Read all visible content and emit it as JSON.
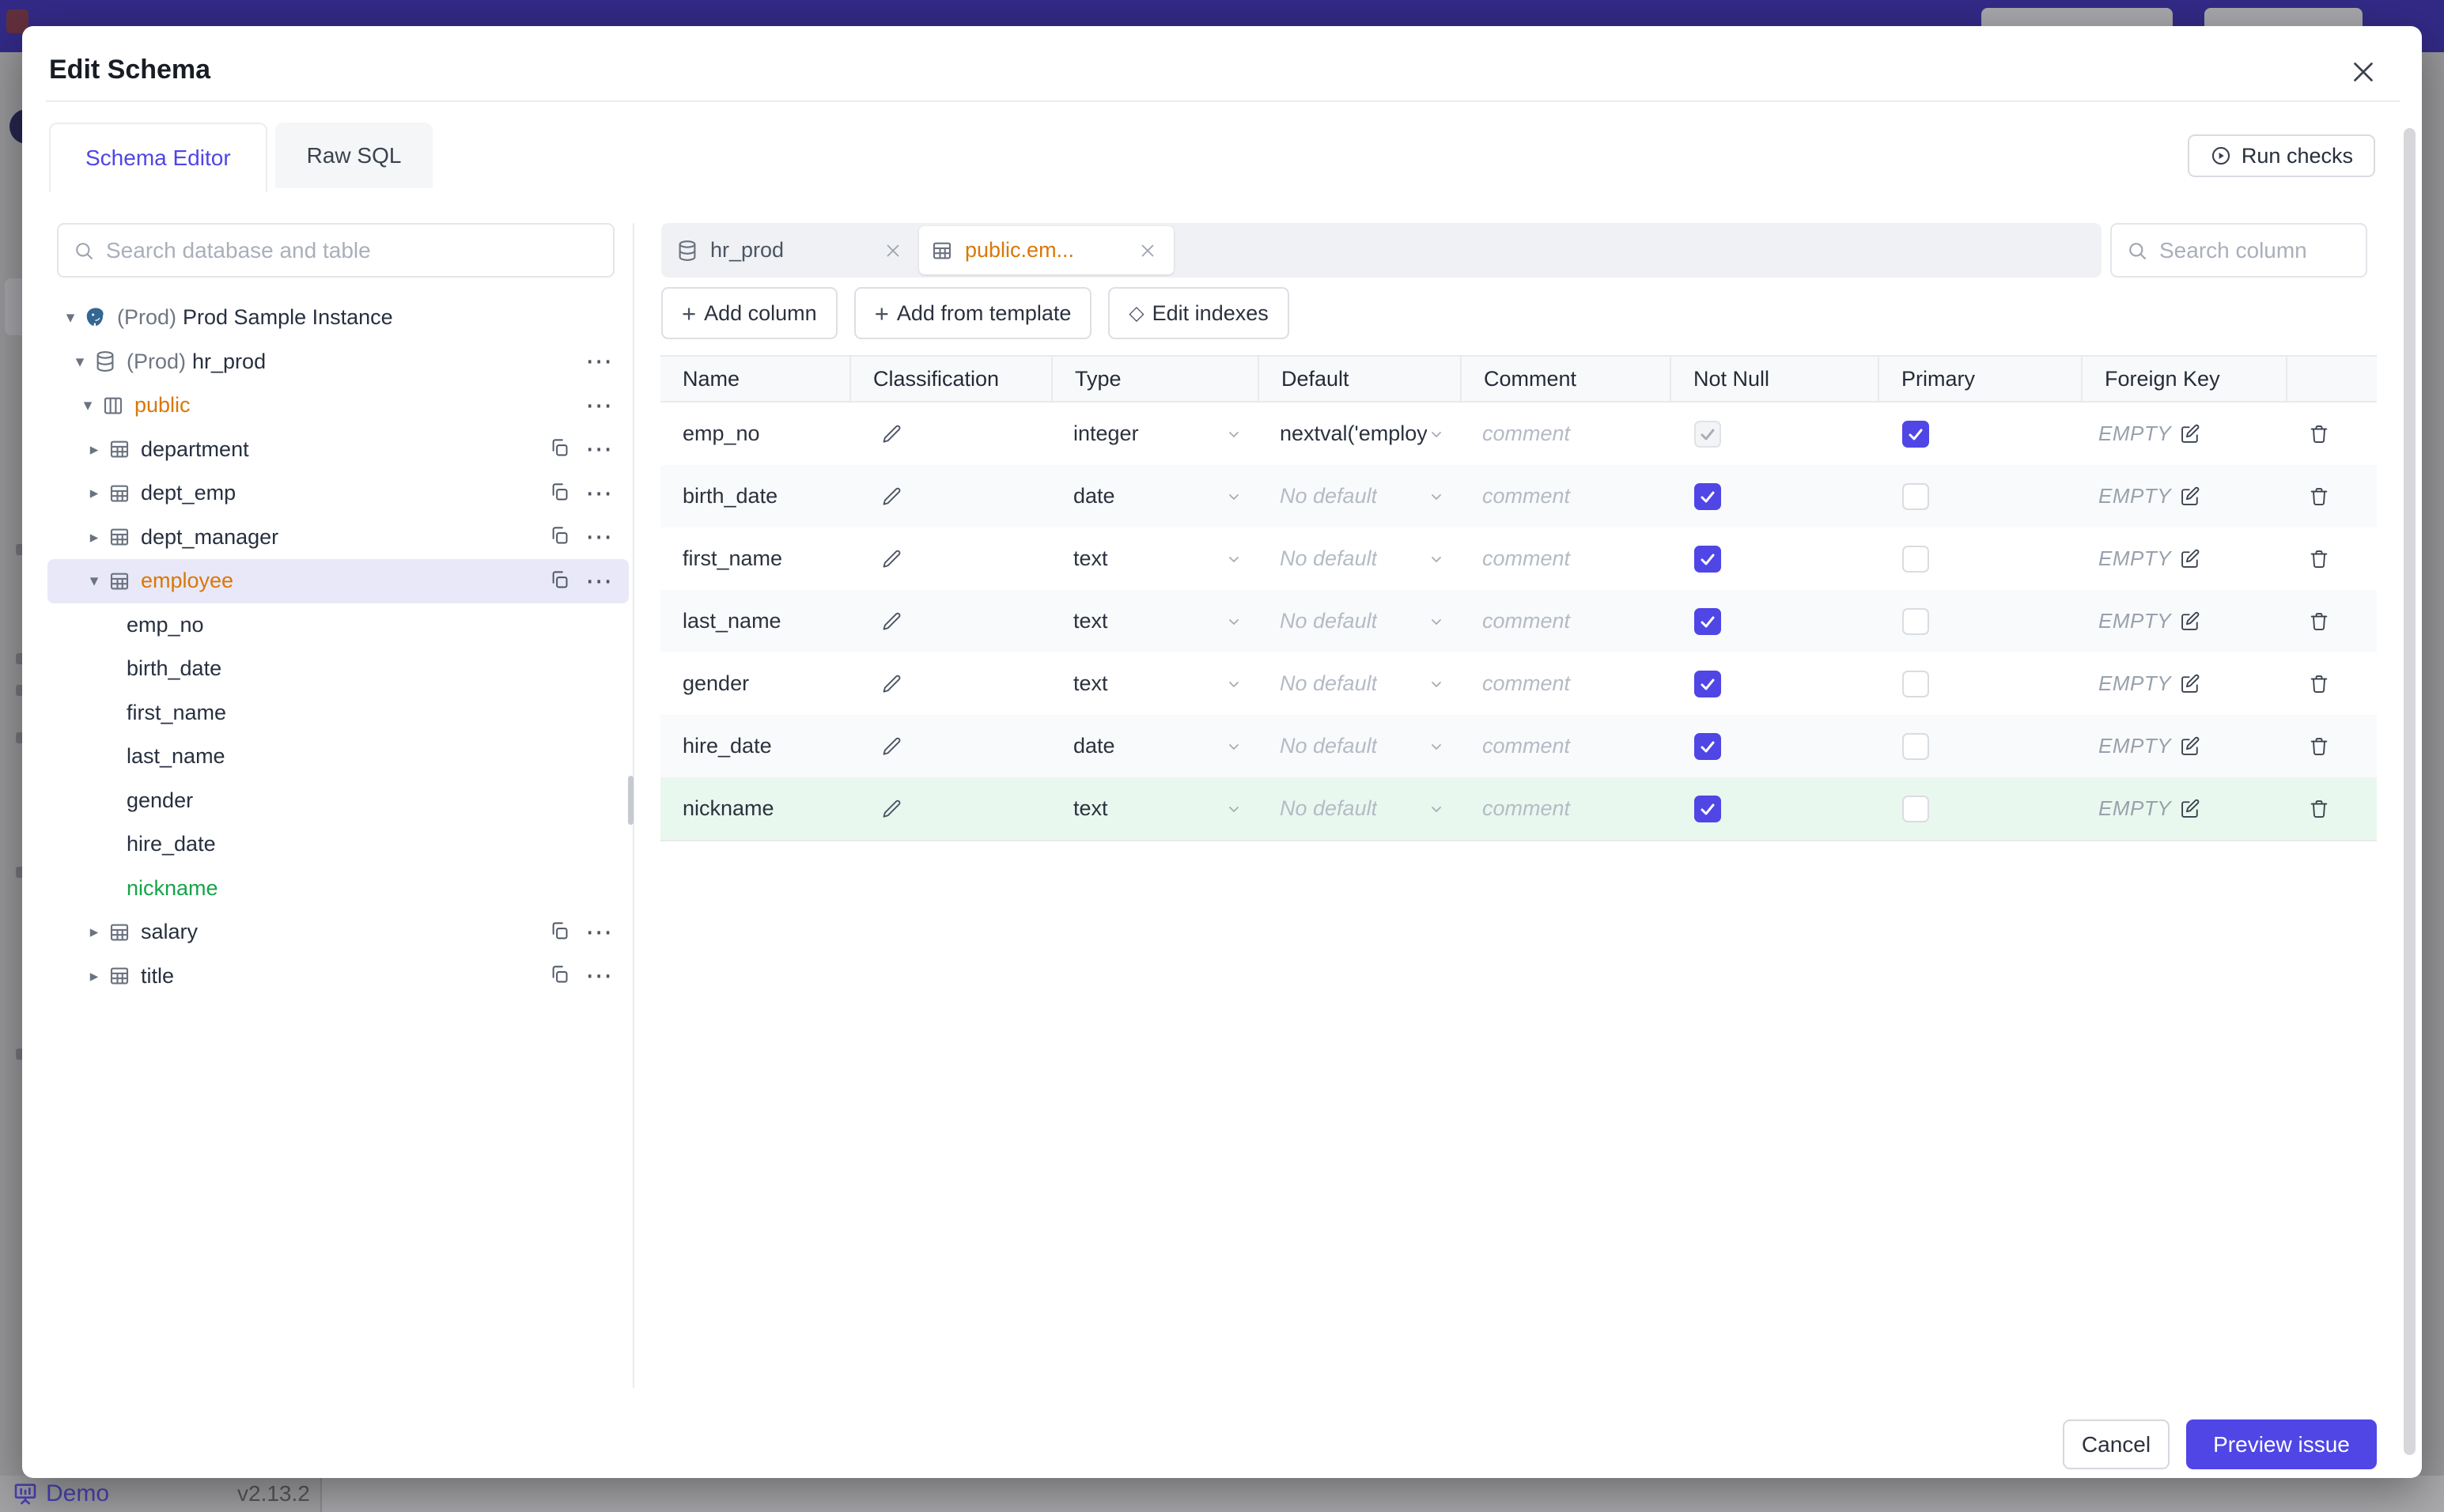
{
  "backdrop": {
    "demo_label": "Demo",
    "version": "v2.13.2"
  },
  "modal": {
    "title": "Edit Schema",
    "tabs": [
      {
        "label": "Schema Editor"
      },
      {
        "label": "Raw SQL"
      }
    ],
    "run_checks_label": "Run checks",
    "sidebar": {
      "search_placeholder": "Search database and table",
      "tree": [
        {
          "level": 0,
          "caret": "down",
          "icon": "postgres",
          "prefix": "(Prod)",
          "label": "Prod Sample Instance",
          "actions": []
        },
        {
          "level": 1,
          "caret": "down",
          "icon": "database",
          "prefix": "(Prod)",
          "label": "hr_prod",
          "actions": [
            "more"
          ]
        },
        {
          "level": 2,
          "caret": "down",
          "icon": "schema",
          "label": "public",
          "amber": true,
          "actions": [
            "more"
          ]
        },
        {
          "level": 3,
          "caret": "right",
          "icon": "table",
          "label": "department",
          "actions": [
            "copy",
            "more"
          ]
        },
        {
          "level": 3,
          "caret": "right",
          "icon": "table",
          "label": "dept_emp",
          "actions": [
            "copy",
            "more"
          ]
        },
        {
          "level": 3,
          "caret": "right",
          "icon": "table",
          "label": "dept_manager",
          "actions": [
            "copy",
            "more"
          ]
        },
        {
          "level": 3,
          "caret": "down",
          "icon": "table",
          "label": "employee",
          "amber": true,
          "selected": true,
          "actions": [
            "copy",
            "more"
          ]
        },
        {
          "level": 4,
          "label": "emp_no"
        },
        {
          "level": 4,
          "label": "birth_date"
        },
        {
          "level": 4,
          "label": "first_name"
        },
        {
          "level": 4,
          "label": "last_name"
        },
        {
          "level": 4,
          "label": "gender"
        },
        {
          "level": 4,
          "label": "hire_date"
        },
        {
          "level": 4,
          "label": "nickname",
          "green": true
        },
        {
          "level": 3,
          "caret": "right",
          "icon": "table",
          "label": "salary",
          "actions": [
            "copy",
            "more"
          ]
        },
        {
          "level": 3,
          "caret": "right",
          "icon": "table",
          "label": "title",
          "actions": [
            "copy",
            "more"
          ]
        }
      ]
    },
    "editor": {
      "tabs": [
        {
          "label": "hr_prod",
          "icon": "database"
        },
        {
          "label": "public.em...",
          "icon": "table",
          "active": true
        }
      ],
      "toolbar": [
        {
          "label": "Add column",
          "prefix": "+"
        },
        {
          "label": "Add from template",
          "prefix": "+"
        },
        {
          "label": "Edit indexes",
          "prefix": "◇"
        }
      ],
      "search_placeholder": "Search column",
      "table": {
        "columns": [
          "Name",
          "Classification",
          "Type",
          "Default",
          "Comment",
          "Not Null",
          "Primary",
          "Foreign Key"
        ],
        "comment_placeholder": "comment",
        "foreign_key_empty": "EMPTY",
        "rows": [
          {
            "name": "emp_no",
            "type": "integer",
            "default": "nextval('employ",
            "default_is_placeholder": false,
            "not_null": "checked-disabled",
            "primary": "checked"
          },
          {
            "name": "birth_date",
            "type": "date",
            "default": "No default",
            "default_is_placeholder": true,
            "not_null": "checked",
            "primary": "unchecked"
          },
          {
            "name": "first_name",
            "type": "text",
            "default": "No default",
            "default_is_placeholder": true,
            "not_null": "checked",
            "primary": "unchecked"
          },
          {
            "name": "last_name",
            "type": "text",
            "default": "No default",
            "default_is_placeholder": true,
            "not_null": "checked",
            "primary": "unchecked"
          },
          {
            "name": "gender",
            "type": "text",
            "default": "No default",
            "default_is_placeholder": true,
            "not_null": "checked",
            "primary": "unchecked"
          },
          {
            "name": "hire_date",
            "type": "date",
            "default": "No default",
            "default_is_placeholder": true,
            "not_null": "checked",
            "primary": "unchecked"
          },
          {
            "name": "nickname",
            "type": "text",
            "default": "No default",
            "default_is_placeholder": true,
            "not_null": "checked",
            "primary": "unchecked",
            "is_new": true
          }
        ]
      }
    },
    "footer": {
      "cancel_label": "Cancel",
      "submit_label": "Preview issue"
    }
  },
  "colors": {
    "accent": "#4F46E5",
    "amber": "#D97706",
    "green": "#16A34A",
    "green_row": "#E9F8EF",
    "selected_row": "#E9E8F8",
    "topbar": "#322A86"
  }
}
